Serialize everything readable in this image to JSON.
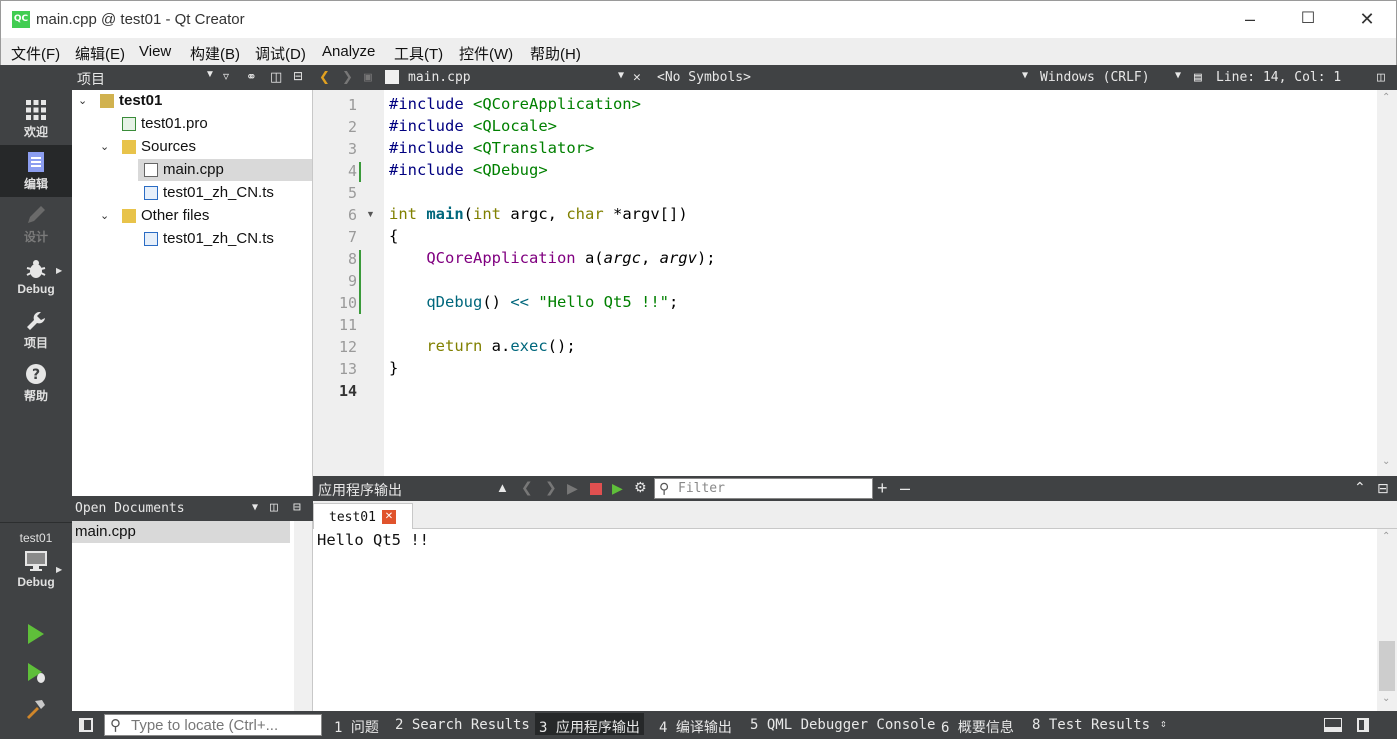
{
  "window": {
    "title": "main.cpp @ test01 - Qt Creator",
    "logo": "QC"
  },
  "menu": [
    "文件(F)",
    "编辑(E)",
    "View",
    "构建(B)",
    "调试(D)",
    "Analyze",
    "工具(T)",
    "控件(W)",
    "帮助(H)"
  ],
  "modes": {
    "welcome": "欢迎",
    "edit": "编辑",
    "design": "设计",
    "debug": "Debug",
    "projects": "项目",
    "help": "帮助"
  },
  "kit": {
    "project": "test01",
    "mode": "Debug"
  },
  "project_pane": {
    "title": "项目",
    "root": "test01",
    "pro_file": "test01.pro",
    "sources": "Sources",
    "main_file": "main.cpp",
    "ts_file": "test01_zh_CN.ts",
    "other_files": "Other files",
    "other_ts": "test01_zh_CN.ts"
  },
  "open_docs": {
    "title": "Open Documents",
    "items": [
      "main.cpp"
    ]
  },
  "editor": {
    "file": "main.cpp",
    "symbols": "<No Symbols>",
    "line_ending": "Windows (CRLF)",
    "position": "Line: 14, Col: 1",
    "line_numbers": [
      "1",
      "2",
      "3",
      "4",
      "5",
      "6",
      "7",
      "8",
      "9",
      "10",
      "11",
      "12",
      "13",
      "14"
    ],
    "code": {
      "l1a": "#include ",
      "l1b": "<QCoreApplication>",
      "l2a": "#include ",
      "l2b": "<QLocale>",
      "l3a": "#include ",
      "l3b": "<QTranslator>",
      "l4a": "#include ",
      "l4b": "<QDebug>",
      "l6a": "int",
      "l6b": " ",
      "l6c": "main",
      "l6d": "(",
      "l6e": "int",
      "l6f": " argc, ",
      "l6g": "char",
      "l6h": " *argv[])",
      "l7": "{",
      "l8a": "    ",
      "l8b": "QCoreApplication",
      "l8c": " a(",
      "l8d": "argc",
      "l8e": ", ",
      "l8f": "argv",
      "l8g": ");",
      "l10a": "    ",
      "l10b": "qDebug",
      "l10c": "() ",
      "l10d": "<<",
      "l10e": " ",
      "l10f": "\"Hello Qt5 !!\"",
      "l10g": ";",
      "l12a": "    ",
      "l12b": "return",
      "l12c": " a.",
      "l12d": "exec",
      "l12e": "();",
      "l13": "}"
    }
  },
  "output": {
    "title": "应用程序输出",
    "filter_placeholder": "Filter",
    "tab": "test01",
    "text": "Hello Qt5 !!"
  },
  "statusbar": {
    "locate_placeholder": "Type to locate (Ctrl+...",
    "tabs": [
      "1 问题",
      "2 Search Results",
      "3 应用程序输出",
      "4 编译输出",
      "5 QML Debugger Console",
      "6 概要信息",
      "8 Test Results"
    ]
  },
  "colors": {
    "accent": "#41cd52",
    "sidebar": "#404244",
    "active": "#262829"
  }
}
